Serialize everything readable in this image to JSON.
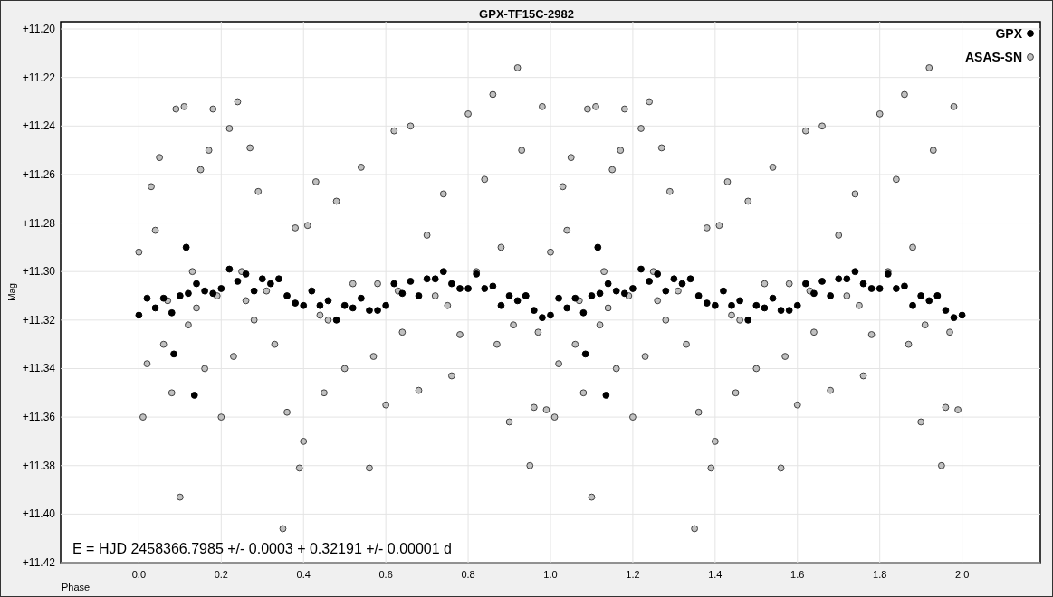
{
  "chart": {
    "chart_data": {
      "type": "scatter",
      "grid": true,
      "legend": "upper right",
      "title": "GPX-TF15C-2982",
      "xlabel": "Phase",
      "ylabel": "Mag",
      "xlim": [
        -0.19,
        2.19
      ],
      "ylim": [
        11.42,
        11.197
      ],
      "xticks": [
        {
          "value": 0,
          "label": "0.0"
        },
        {
          "value": 0.2,
          "label": "0.2"
        },
        {
          "value": 0.4,
          "label": "0.4"
        },
        {
          "value": 0.6,
          "label": "0.6"
        },
        {
          "value": 0.8,
          "label": "0.8"
        },
        {
          "value": 1,
          "label": "1.0"
        },
        {
          "value": 1.2,
          "label": "1.2"
        },
        {
          "value": 1.4,
          "label": "1.4"
        },
        {
          "value": 1.6,
          "label": "1.6"
        },
        {
          "value": 1.8,
          "label": "1.8"
        },
        {
          "value": 2,
          "label": "2.0"
        }
      ],
      "yticks": [
        {
          "value": 11.2,
          "label": "+11.20"
        },
        {
          "value": 11.22,
          "label": "+11.22"
        },
        {
          "value": 11.24,
          "label": "+11.24"
        },
        {
          "value": 11.26,
          "label": "+11.26"
        },
        {
          "value": 11.28,
          "label": "+11.28"
        },
        {
          "value": 11.3,
          "label": "+11.30"
        },
        {
          "value": 11.32,
          "label": "+11.32"
        },
        {
          "value": 11.34,
          "label": "+11.34"
        },
        {
          "value": 11.36,
          "label": "+11.36"
        },
        {
          "value": 11.38,
          "label": "+11.38"
        },
        {
          "value": 11.4,
          "label": "+11.40"
        },
        {
          "value": 11.42,
          "label": "+11.42"
        }
      ],
      "annotations": [
        {
          "text": "E = HJD 2458366.7985 +/- 0.0003 + 0.32191 +/- 0.00001 d"
        }
      ],
      "series": [
        {
          "name": "ASAS-SN",
          "color": "#c0c0c0",
          "x": [
            0.0,
            0.01,
            0.02,
            0.03,
            0.04,
            0.05,
            0.06,
            0.07,
            0.08,
            0.09,
            0.1,
            0.11,
            0.12,
            0.13,
            0.15,
            0.16,
            0.17,
            0.18,
            0.19,
            0.2,
            0.22,
            0.23,
            0.24,
            0.25,
            0.27,
            0.28,
            0.29,
            0.31,
            0.33,
            0.35,
            0.36,
            0.38,
            0.39,
            0.4,
            0.41,
            0.43,
            0.45,
            0.46,
            0.48,
            0.5,
            0.52,
            0.54,
            0.56,
            0.57,
            0.58,
            0.6,
            0.62,
            0.64,
            0.66,
            0.68,
            0.7,
            0.72,
            0.74,
            0.76,
            0.78,
            0.8,
            0.82,
            0.84,
            0.86,
            0.87,
            0.88,
            0.9,
            0.92,
            0.93,
            0.94,
            0.95,
            0.96,
            0.97,
            0.98,
            0.99,
            0.14,
            0.26,
            0.44,
            0.63,
            0.75,
            0.91,
            1.0,
            1.01,
            1.02,
            1.03,
            1.04,
            1.05,
            1.06,
            1.07,
            1.08,
            1.09,
            1.1,
            1.11,
            1.12,
            1.13,
            1.15,
            1.16,
            1.17,
            1.18,
            1.19,
            1.2,
            1.22,
            1.23,
            1.24,
            1.25,
            1.27,
            1.28,
            1.29,
            1.31,
            1.33,
            1.35,
            1.36,
            1.38,
            1.39,
            1.4,
            1.41,
            1.43,
            1.45,
            1.46,
            1.48,
            1.5,
            1.52,
            1.54,
            1.56,
            1.57,
            1.58,
            1.6,
            1.62,
            1.64,
            1.66,
            1.68,
            1.7,
            1.72,
            1.74,
            1.76,
            1.78,
            1.8,
            1.82,
            1.84,
            1.86,
            1.87,
            1.88,
            1.9,
            1.92,
            1.93,
            1.94,
            1.95,
            1.96,
            1.97,
            1.98,
            1.99,
            1.14,
            1.26,
            1.44,
            1.63,
            1.75,
            1.91
          ],
          "values": [
            11.292,
            11.36,
            11.338,
            11.265,
            11.283,
            11.253,
            11.33,
            11.312,
            11.35,
            11.233,
            11.393,
            11.232,
            11.322,
            11.3,
            11.258,
            11.34,
            11.25,
            11.233,
            11.31,
            11.36,
            11.241,
            11.335,
            11.23,
            11.3,
            11.249,
            11.32,
            11.267,
            11.308,
            11.33,
            11.406,
            11.358,
            11.282,
            11.381,
            11.37,
            11.281,
            11.263,
            11.35,
            11.32,
            11.271,
            11.34,
            11.305,
            11.257,
            11.381,
            11.335,
            11.305,
            11.355,
            11.242,
            11.325,
            11.24,
            11.349,
            11.285,
            11.31,
            11.268,
            11.343,
            11.326,
            11.235,
            11.3,
            11.262,
            11.227,
            11.33,
            11.29,
            11.362,
            11.216,
            11.25,
            11.31,
            11.38,
            11.356,
            11.325,
            11.232,
            11.357,
            11.315,
            11.312,
            11.318,
            11.308,
            11.314,
            11.322,
            11.292,
            11.36,
            11.338,
            11.265,
            11.283,
            11.253,
            11.33,
            11.312,
            11.35,
            11.233,
            11.393,
            11.232,
            11.322,
            11.3,
            11.258,
            11.34,
            11.25,
            11.233,
            11.31,
            11.36,
            11.241,
            11.335,
            11.23,
            11.3,
            11.249,
            11.32,
            11.267,
            11.308,
            11.33,
            11.406,
            11.358,
            11.282,
            11.381,
            11.37,
            11.281,
            11.263,
            11.35,
            11.32,
            11.271,
            11.34,
            11.305,
            11.257,
            11.381,
            11.335,
            11.305,
            11.355,
            11.242,
            11.325,
            11.24,
            11.349,
            11.285,
            11.31,
            11.268,
            11.343,
            11.326,
            11.235,
            11.3,
            11.262,
            11.227,
            11.33,
            11.29,
            11.362,
            11.216,
            11.25,
            11.31,
            11.38,
            11.356,
            11.325,
            11.232,
            11.357,
            11.315,
            11.312,
            11.318,
            11.308,
            11.314,
            11.322
          ]
        },
        {
          "name": "GPX",
          "color": "#000000",
          "x": [
            0.0,
            0.02,
            0.04,
            0.06,
            0.08,
            0.1,
            0.12,
            0.14,
            0.16,
            0.18,
            0.2,
            0.22,
            0.24,
            0.26,
            0.28,
            0.3,
            0.32,
            0.34,
            0.36,
            0.38,
            0.4,
            0.42,
            0.44,
            0.46,
            0.48,
            0.5,
            0.52,
            0.54,
            0.56,
            0.58,
            0.6,
            0.62,
            0.64,
            0.66,
            0.68,
            0.7,
            0.72,
            0.74,
            0.76,
            0.78,
            0.8,
            0.82,
            0.84,
            0.86,
            0.88,
            0.9,
            0.92,
            0.94,
            0.96,
            0.98,
            0.085,
            0.135,
            0.115,
            1.0,
            1.02,
            1.04,
            1.06,
            1.08,
            1.1,
            1.12,
            1.14,
            1.16,
            1.18,
            1.2,
            1.22,
            1.24,
            1.26,
            1.28,
            1.3,
            1.32,
            1.34,
            1.36,
            1.38,
            1.4,
            1.42,
            1.44,
            1.46,
            1.48,
            1.5,
            1.52,
            1.54,
            1.56,
            1.58,
            1.6,
            1.62,
            1.64,
            1.66,
            1.68,
            1.7,
            1.72,
            1.74,
            1.76,
            1.78,
            1.8,
            1.82,
            1.84,
            1.86,
            1.88,
            1.9,
            1.92,
            1.94,
            1.96,
            1.98,
            1.085,
            1.135,
            1.115,
            2.0
          ],
          "values": [
            11.318,
            11.311,
            11.315,
            11.311,
            11.317,
            11.31,
            11.309,
            11.305,
            11.308,
            11.309,
            11.307,
            11.299,
            11.304,
            11.301,
            11.308,
            11.303,
            11.305,
            11.303,
            11.31,
            11.313,
            11.314,
            11.308,
            11.314,
            11.312,
            11.32,
            11.314,
            11.315,
            11.311,
            11.316,
            11.316,
            11.314,
            11.305,
            11.309,
            11.304,
            11.31,
            11.303,
            11.303,
            11.3,
            11.305,
            11.307,
            11.307,
            11.301,
            11.307,
            11.306,
            11.314,
            11.31,
            11.312,
            11.31,
            11.316,
            11.319,
            11.334,
            11.351,
            11.29,
            11.318,
            11.311,
            11.315,
            11.311,
            11.317,
            11.31,
            11.309,
            11.305,
            11.308,
            11.309,
            11.307,
            11.299,
            11.304,
            11.301,
            11.308,
            11.303,
            11.305,
            11.303,
            11.31,
            11.313,
            11.314,
            11.308,
            11.314,
            11.312,
            11.32,
            11.314,
            11.315,
            11.311,
            11.316,
            11.316,
            11.314,
            11.305,
            11.309,
            11.304,
            11.31,
            11.303,
            11.303,
            11.3,
            11.305,
            11.307,
            11.307,
            11.301,
            11.307,
            11.306,
            11.314,
            11.31,
            11.312,
            11.31,
            11.316,
            11.319,
            11.334,
            11.351,
            11.29,
            11.318
          ]
        }
      ]
    }
  }
}
